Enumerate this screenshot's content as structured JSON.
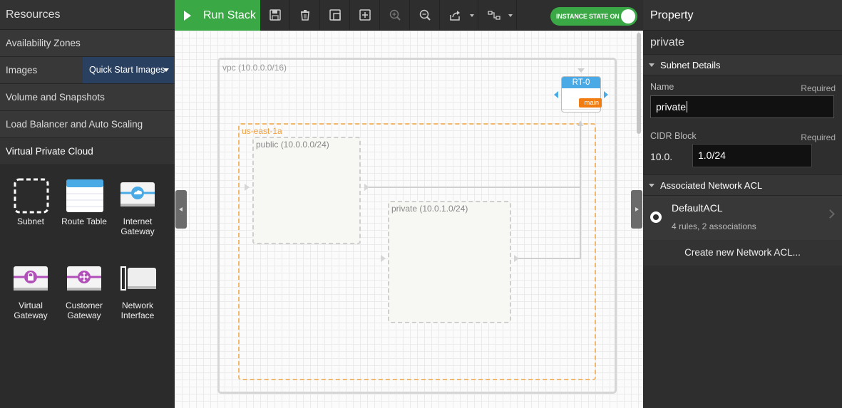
{
  "left": {
    "header": "Resources",
    "items": [
      {
        "label": "Availability Zones"
      },
      {
        "label": "Images"
      },
      {
        "label": "Volume and Snapshots"
      },
      {
        "label": "Load Balancer and Auto Scaling"
      },
      {
        "label": "Virtual Private Cloud"
      }
    ],
    "images_dropdown": "Quick Start Images",
    "palette": [
      {
        "label": "Subnet",
        "icon": "dashed-square-icon"
      },
      {
        "label": "Route Table",
        "icon": "route-table-icon"
      },
      {
        "label": "Internet Gateway",
        "icon": "cloud-gateway-icon"
      },
      {
        "label": "Virtual Gateway",
        "icon": "lock-gateway-icon"
      },
      {
        "label": "Customer Gateway",
        "icon": "move-gateway-icon"
      },
      {
        "label": "Network Interface",
        "icon": "network-interface-icon"
      }
    ]
  },
  "toolbar": {
    "run_label": "Run Stack",
    "instance_state_label": "INSTANCE STATE ON",
    "icons": [
      "save-icon",
      "delete-icon",
      "duplicate-icon",
      "add-icon",
      "zoom-in-icon",
      "zoom-out-icon",
      "export-icon",
      "connection-style-icon"
    ]
  },
  "canvas": {
    "vpc_label": "vpc (10.0.0.0/16)",
    "az_label": "us-east-1a",
    "public_subnet_label": "public (10.0.0.0/24)",
    "private_subnet_label": "private (10.0.1.0/24)",
    "route_table_label": "RT-0",
    "route_table_badge": "main"
  },
  "property": {
    "header": "Property",
    "title": "private",
    "subnet_section": "Subnet Details",
    "name_label": "Name",
    "name_required": "Required",
    "name_value": "private",
    "cidr_label": "CIDR Block",
    "cidr_required": "Required",
    "cidr_prefix": "10.0.",
    "cidr_value": "1.0/24",
    "acl_section": "Associated Network ACL",
    "acl_name": "DefaultACL",
    "acl_desc": "4 rules, 2 associations",
    "create_acl": "Create new Network ACL..."
  },
  "colors": {
    "run_green": "#3aa845",
    "images_blue": "#2a4060",
    "az_orange": "#f1b86b",
    "rt_blue": "#4aaae6",
    "badge_orange": "#f07c12"
  }
}
